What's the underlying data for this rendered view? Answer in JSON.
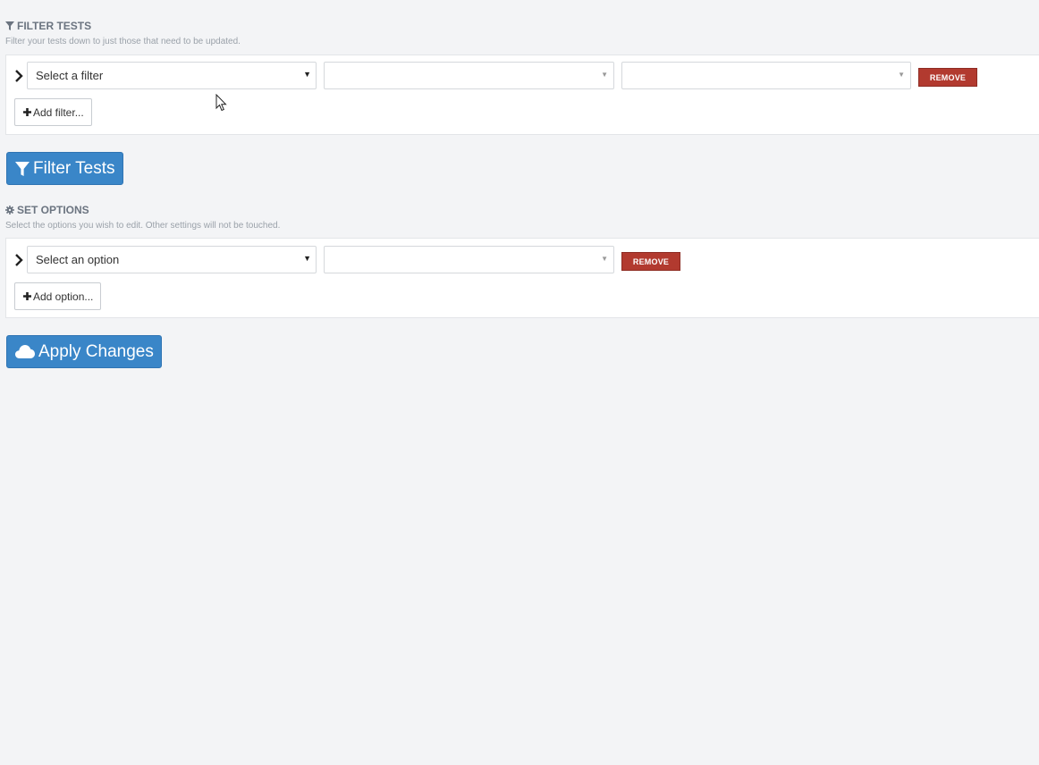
{
  "filter_section": {
    "title": "FILTER TESTS",
    "icon": "filter-icon",
    "description": "Filter your tests down to just those that need to be updated.",
    "row": {
      "select_primary": "Select a filter",
      "select_secondary": "",
      "select_tertiary": "",
      "remove_label": "REMOVE"
    },
    "add_label": "Add filter...",
    "submit_label": "Filter Tests"
  },
  "options_section": {
    "title": "SET OPTIONS",
    "icon": "gear-icon",
    "description": "Select the options you wish to edit. Other settings will not be touched.",
    "row": {
      "select_primary": "Select an option",
      "select_secondary": "",
      "remove_label": "REMOVE"
    },
    "add_label": "Add option...",
    "submit_label": "Apply Changes",
    "submit_icon": "cloud-icon"
  },
  "colors": {
    "primary": "#3a86c8",
    "danger": "#b23a2f",
    "background": "#f3f4f6"
  }
}
